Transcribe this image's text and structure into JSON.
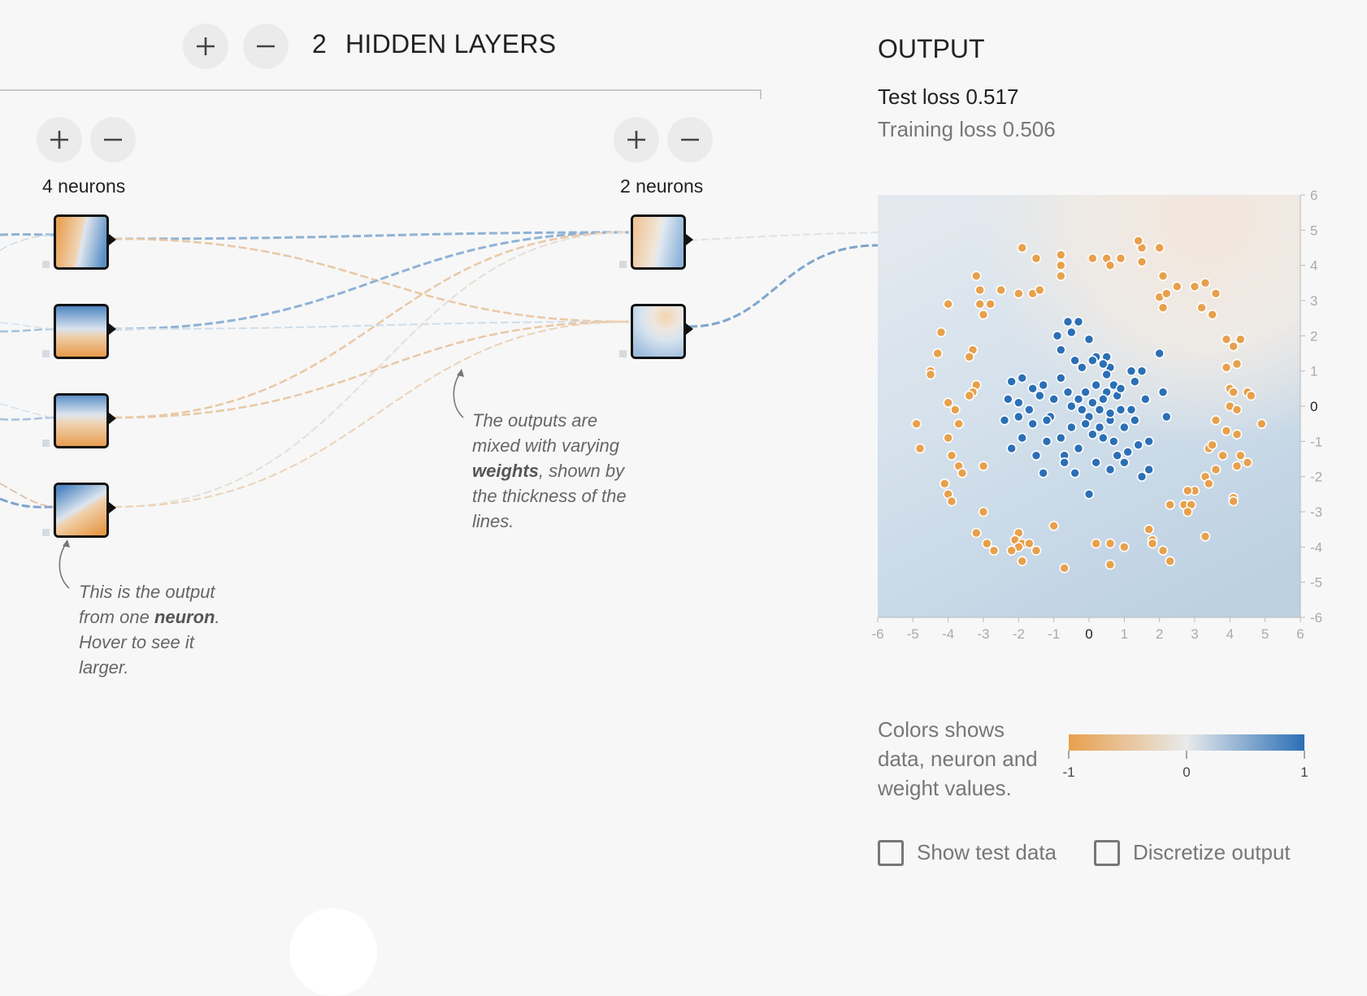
{
  "hidden_layers": {
    "count": "2",
    "label": "HIDDEN LAYERS"
  },
  "layers": [
    {
      "neurons_label": "4 neurons"
    },
    {
      "neurons_label": "2 neurons"
    }
  ],
  "annotations": {
    "neuron_note": {
      "part1": "This is the output from one ",
      "bold": "neuron",
      "part2": ". Hover to see it larger."
    },
    "weights_note": {
      "part1": "The outputs are mixed with varying ",
      "bold": "weights",
      "part2": ", shown by the thickness of the lines."
    }
  },
  "output": {
    "title": "OUTPUT",
    "test_loss": "Test loss 0.517",
    "training_loss": "Training loss 0.506"
  },
  "legend": {
    "text": "Colors shows data, neuron and weight values.",
    "ticks": [
      "-1",
      "0",
      "1"
    ],
    "colors": {
      "negative": "#e8a04c",
      "neutral": "#e8eaeb",
      "positive": "#2b6fb6"
    }
  },
  "checkboxes": {
    "show_test_data": {
      "label": "Show test data",
      "checked": false
    },
    "discretize_output": {
      "label": "Discretize output",
      "checked": false
    }
  },
  "chart_data": {
    "type": "scatter",
    "title": "",
    "xlim": [
      -6,
      6
    ],
    "ylim": [
      -6,
      6
    ],
    "x_ticks": [
      "-6",
      "-5",
      "-4",
      "-3",
      "-2",
      "-1",
      "0",
      "1",
      "2",
      "3",
      "4",
      "5",
      "6"
    ],
    "y_ticks": [
      "6",
      "5",
      "4",
      "3",
      "2",
      "1",
      "0",
      "-1",
      "-2",
      "-3",
      "-4",
      "-5",
      "-6"
    ],
    "series": [
      {
        "color": "#2b6fb6",
        "class": 1,
        "points": [
          [
            -0.6,
            2.4
          ],
          [
            -0.9,
            2.0
          ],
          [
            -0.5,
            2.1
          ],
          [
            -0.3,
            2.4
          ],
          [
            0.0,
            1.9
          ],
          [
            -0.8,
            1.6
          ],
          [
            -0.4,
            1.3
          ],
          [
            0.2,
            1.4
          ],
          [
            0.5,
            1.4
          ],
          [
            0.6,
            1.1
          ],
          [
            1.2,
            1.0
          ],
          [
            1.5,
            1.0
          ],
          [
            2.0,
            1.5
          ],
          [
            -2.2,
            0.7
          ],
          [
            -1.9,
            0.8
          ],
          [
            -1.6,
            0.5
          ],
          [
            -1.3,
            0.6
          ],
          [
            -0.8,
            0.8
          ],
          [
            -0.2,
            1.1
          ],
          [
            0.1,
            1.3
          ],
          [
            0.4,
            1.2
          ],
          [
            0.7,
            0.6
          ],
          [
            1.3,
            0.7
          ],
          [
            2.1,
            0.4
          ],
          [
            -2.3,
            0.2
          ],
          [
            -2.0,
            0.1
          ],
          [
            -1.7,
            -0.1
          ],
          [
            -1.4,
            0.3
          ],
          [
            -1.0,
            0.2
          ],
          [
            -0.5,
            0.0
          ],
          [
            -0.1,
            0.4
          ],
          [
            0.2,
            0.6
          ],
          [
            0.5,
            0.4
          ],
          [
            0.8,
            0.3
          ],
          [
            1.2,
            -0.1
          ],
          [
            1.6,
            0.2
          ],
          [
            -2.4,
            -0.4
          ],
          [
            -2.0,
            -0.3
          ],
          [
            -1.6,
            -0.5
          ],
          [
            -1.1,
            -0.3
          ],
          [
            -0.5,
            -0.6
          ],
          [
            0.0,
            -0.3
          ],
          [
            0.3,
            -0.1
          ],
          [
            0.6,
            -0.4
          ],
          [
            0.9,
            -0.1
          ],
          [
            1.3,
            -0.4
          ],
          [
            2.2,
            -0.3
          ],
          [
            -2.2,
            -1.2
          ],
          [
            -1.9,
            -0.9
          ],
          [
            -1.5,
            -1.4
          ],
          [
            -1.2,
            -1.0
          ],
          [
            -0.7,
            -1.4
          ],
          [
            -0.3,
            -1.2
          ],
          [
            0.1,
            -0.8
          ],
          [
            0.4,
            -0.9
          ],
          [
            0.7,
            -1.0
          ],
          [
            1.1,
            -1.3
          ],
          [
            1.7,
            -1.0
          ],
          [
            -1.3,
            -1.9
          ],
          [
            -0.7,
            -1.6
          ],
          [
            -0.4,
            -1.9
          ],
          [
            0.2,
            -1.6
          ],
          [
            0.6,
            -1.8
          ],
          [
            1.0,
            -1.6
          ],
          [
            1.5,
            -2.0
          ],
          [
            1.7,
            -1.8
          ],
          [
            0.0,
            -2.5
          ],
          [
            -0.2,
            -0.1
          ],
          [
            0.1,
            0.1
          ],
          [
            0.4,
            0.2
          ],
          [
            0.6,
            -0.2
          ],
          [
            0.3,
            -0.6
          ],
          [
            -0.1,
            -0.5
          ],
          [
            -0.3,
            0.2
          ],
          [
            0.9,
            0.5
          ],
          [
            1.0,
            -0.6
          ],
          [
            -0.8,
            -0.9
          ],
          [
            -0.6,
            0.4
          ],
          [
            0.5,
            0.9
          ],
          [
            -1.2,
            -0.4
          ],
          [
            1.4,
            -1.1
          ],
          [
            0.8,
            -1.4
          ]
        ]
      },
      {
        "color": "#e8a04c",
        "class": -1,
        "points": [
          [
            -1.9,
            4.5
          ],
          [
            -1.5,
            4.2
          ],
          [
            -0.8,
            4.3
          ],
          [
            -0.8,
            4.0
          ],
          [
            -0.8,
            3.7
          ],
          [
            0.1,
            4.2
          ],
          [
            0.5,
            4.2
          ],
          [
            0.9,
            4.2
          ],
          [
            1.5,
            4.5
          ],
          [
            1.4,
            4.7
          ],
          [
            2.0,
            4.5
          ],
          [
            0.6,
            4.0
          ],
          [
            1.5,
            4.1
          ],
          [
            -3.2,
            3.7
          ],
          [
            -3.1,
            3.3
          ],
          [
            -3.1,
            2.9
          ],
          [
            -2.8,
            2.9
          ],
          [
            -2.5,
            3.3
          ],
          [
            -1.6,
            3.2
          ],
          [
            -1.4,
            3.3
          ],
          [
            -2.0,
            3.2
          ],
          [
            -3.0,
            2.6
          ],
          [
            -4.0,
            2.9
          ],
          [
            2.1,
            3.7
          ],
          [
            2.5,
            3.4
          ],
          [
            2.0,
            3.1
          ],
          [
            3.0,
            3.4
          ],
          [
            3.3,
            3.5
          ],
          [
            3.6,
            3.2
          ],
          [
            3.2,
            2.8
          ],
          [
            3.5,
            2.6
          ],
          [
            2.1,
            2.8
          ],
          [
            2.2,
            3.2
          ],
          [
            -4.2,
            2.1
          ],
          [
            -4.3,
            1.5
          ],
          [
            -3.3,
            1.6
          ],
          [
            -3.4,
            1.4
          ],
          [
            -4.5,
            1.0
          ],
          [
            -4.5,
            0.9
          ],
          [
            -3.2,
            0.6
          ],
          [
            -3.3,
            0.4
          ],
          [
            -3.4,
            0.3
          ],
          [
            -4.0,
            0.1
          ],
          [
            -3.8,
            -0.1
          ],
          [
            3.9,
            1.9
          ],
          [
            4.3,
            1.9
          ],
          [
            4.1,
            1.7
          ],
          [
            4.2,
            1.2
          ],
          [
            3.9,
            1.1
          ],
          [
            4.0,
            0.5
          ],
          [
            4.1,
            0.4
          ],
          [
            4.5,
            0.4
          ],
          [
            4.6,
            0.3
          ],
          [
            4.0,
            0.0
          ],
          [
            4.2,
            -0.1
          ],
          [
            -4.9,
            -0.5
          ],
          [
            -3.7,
            -0.5
          ],
          [
            -4.0,
            -0.9
          ],
          [
            -4.8,
            -1.2
          ],
          [
            -3.9,
            -1.4
          ],
          [
            -3.7,
            -1.7
          ],
          [
            -3.6,
            -1.9
          ],
          [
            -3.0,
            -1.7
          ],
          [
            -4.1,
            -2.2
          ],
          [
            -4.0,
            -2.5
          ],
          [
            -3.9,
            -2.7
          ],
          [
            3.6,
            -0.4
          ],
          [
            3.9,
            -0.7
          ],
          [
            4.2,
            -0.8
          ],
          [
            4.9,
            -0.5
          ],
          [
            3.4,
            -1.2
          ],
          [
            3.5,
            -1.1
          ],
          [
            3.8,
            -1.4
          ],
          [
            4.3,
            -1.4
          ],
          [
            4.5,
            -1.6
          ],
          [
            4.2,
            -1.7
          ],
          [
            3.6,
            -1.8
          ],
          [
            3.3,
            -2.0
          ],
          [
            3.4,
            -2.2
          ],
          [
            3.0,
            -2.4
          ],
          [
            -3.0,
            -3.0
          ],
          [
            -3.2,
            -3.6
          ],
          [
            -2.9,
            -3.9
          ],
          [
            -2.7,
            -4.1
          ],
          [
            -2.0,
            -3.6
          ],
          [
            -2.1,
            -3.8
          ],
          [
            -1.9,
            -3.9
          ],
          [
            -2.0,
            -4.0
          ],
          [
            -1.7,
            -3.9
          ],
          [
            -1.5,
            -4.1
          ],
          [
            -2.2,
            -4.1
          ],
          [
            -1.9,
            -4.4
          ],
          [
            -1.0,
            -3.4
          ],
          [
            -0.7,
            -4.6
          ],
          [
            0.2,
            -3.9
          ],
          [
            0.6,
            -3.9
          ],
          [
            1.0,
            -4.0
          ],
          [
            1.7,
            -3.5
          ],
          [
            1.8,
            -3.8
          ],
          [
            1.8,
            -3.9
          ],
          [
            2.1,
            -4.1
          ],
          [
            2.3,
            -4.4
          ],
          [
            0.6,
            -4.5
          ],
          [
            2.3,
            -2.8
          ],
          [
            2.7,
            -2.8
          ],
          [
            2.9,
            -2.8
          ],
          [
            2.8,
            -3.0
          ],
          [
            3.3,
            -3.7
          ],
          [
            4.1,
            -2.6
          ],
          [
            4.1,
            -2.7
          ],
          [
            2.8,
            -2.4
          ]
        ]
      }
    ]
  }
}
